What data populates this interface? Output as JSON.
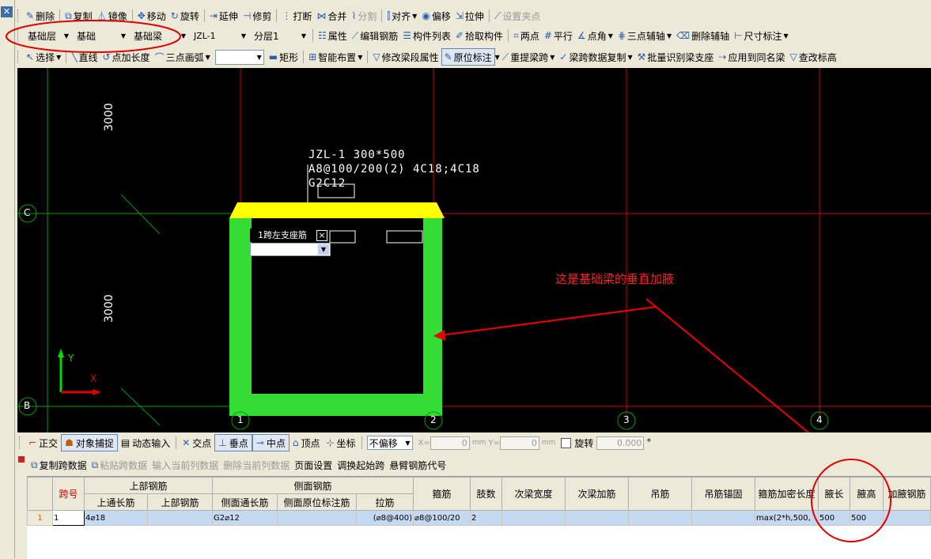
{
  "toolbar1": {
    "delete": "删除",
    "copy": "复制",
    "mirror": "镜像",
    "move": "移动",
    "rotate": "旋转",
    "extend": "延伸",
    "trim": "修剪",
    "break": "打断",
    "merge": "合并",
    "split": "分割",
    "align": "对齐",
    "offset": "偏移",
    "stretch": "拉伸",
    "set_grip": "设置夹点"
  },
  "toolbar2": {
    "layer_combo": "基础层",
    "category_combo": "基础",
    "type_combo": "基础梁",
    "element_combo": "JZL-1",
    "sublayer_combo": "分层1",
    "property": "属性",
    "edit_rebar": "编辑钢筋",
    "element_list": "构件列表",
    "pick_element": "拾取构件",
    "two_points": "两点",
    "parallel": "平行",
    "point_angle": "点角",
    "three_point_aux": "三点辅轴",
    "delete_aux": "删除辅轴",
    "dimension": "尺寸标注"
  },
  "toolbar3": {
    "select": "选择",
    "line": "直线",
    "point_length": "点加长度",
    "three_point_arc": "三点画弧",
    "rect": "矩形",
    "smart_layout": "智能布置",
    "modify_seg_prop": "修改梁段属性",
    "in_place_mark": "原位标注",
    "re_extract_span": "重提梁跨",
    "span_data_copy": "梁跨数据复制",
    "batch_identify": "批量识别梁支座",
    "apply_same": "应用到同名梁",
    "check_mark": "查改标高"
  },
  "cad": {
    "axis_c": "C",
    "axis_b": "B",
    "axis_1": "1",
    "axis_2": "2",
    "axis_3": "3",
    "axis_4": "4",
    "dim_upper": "3000",
    "dim_lower": "3000",
    "beam_line1": "JZL-1 300*500",
    "beam_line2": "A8@100/200(2) 4C18;4C18",
    "beam_line3": "G2C12",
    "popup_label": "1跨左支座筋",
    "popup_close": "×",
    "annotation": "这是基础梁的垂直加腋",
    "ucs_y": "Y",
    "ucs_x": "X"
  },
  "snapbar": {
    "ortho": "正交",
    "object_snap": "对象捕捉",
    "dynamic_input": "动态输入",
    "intersection": "交点",
    "perpendicular": "垂点",
    "midpoint": "中点",
    "vertex": "顶点",
    "coordinate": "坐标",
    "offset_mode": "不偏移",
    "x_label": "X=",
    "x_value": "0",
    "y_label": "Y=",
    "y_value": "0",
    "unit": "mm",
    "rotate": "旋转",
    "rotate_value": "0.000",
    "degree": "°"
  },
  "panel": {
    "copy_span": "复制跨数据",
    "paste_span": "粘贴跨数据",
    "input_col": "输入当前列数据",
    "delete_col": "删除当前列数据",
    "page_setup": "页面设置",
    "swap_start": "调换起始跨",
    "cantilever_code": "悬臂钢筋代号"
  },
  "grid": {
    "group_top": "上部钢筋",
    "group_side": "侧面钢筋",
    "headers": [
      "跨号",
      "上通长筋",
      "上部钢筋",
      "侧面通长筋",
      "侧面原位标注筋",
      "拉筋",
      "箍筋",
      "肢数",
      "次梁宽度",
      "次梁加筋",
      "吊筋",
      "吊筋锚固",
      "箍筋加密长度",
      "腋长",
      "腋高",
      "加腋钢筋"
    ],
    "rows": [
      [
        "1",
        "1",
        "4⌀18",
        "",
        "G2⌀12",
        "",
        "(⌀8@400)",
        "⌀8@100/20",
        "2",
        "",
        "",
        "",
        "",
        "max(2*h,500,",
        "500",
        "500",
        ""
      ]
    ]
  }
}
